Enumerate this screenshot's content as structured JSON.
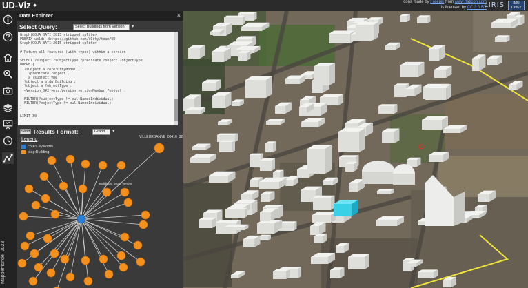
{
  "app": {
    "title": "UD-Viz •",
    "credits_line1_pre": "Icons made by",
    "credits_line1_link1": "Freepik",
    "credits_line1_mid": "from",
    "credits_line1_link2": "www.flaticon.com",
    "credits_line2_pre": "is licensed by",
    "credits_line2_link": "CC 3.0 BY",
    "logo_text": "LIRIS",
    "logo_box_text": "IMU LabEx"
  },
  "sidebar": {
    "items": [
      {
        "icon": "info-icon"
      },
      {
        "icon": "help-icon"
      },
      {
        "icon": "home-icon"
      },
      {
        "icon": "search-buildings-icon"
      },
      {
        "icon": "camera-icon"
      },
      {
        "icon": "layers-icon"
      },
      {
        "icon": "presentation-icon"
      },
      {
        "icon": "clock-icon"
      },
      {
        "icon": "graph-icon"
      }
    ],
    "copyright": "Mappemonde, 2023"
  },
  "panel": {
    "title": "Data Explorer",
    "close": "×",
    "query_label": "Select Query:",
    "query_value": "Select Buildings from Version",
    "query_caret": "▾",
    "editor_lines": [
      "Graph(GOUA_BATI_2015_stripped_splite>",
      "PREFIX ubld: <https://github.com/VCity/team/UD-",
      "Graph(GOUA_BATI_2015_stripped_splite>",
      "",
      "# Return all features (with types) within a version",
      "",
      "SELECT ?subject ?subjectType ?predicate ?object ?objectType",
      "WHERE {",
      "  ?subject a core:CityModel ;",
      "    ?predicate ?object .",
      "    a ?subjectType",
      "  ?object a bldg:Building ;",
      "  ?object a ?objectType .",
      "  <Version_0#2 vers:Version.versionMember ?object .",
      "",
      "  FILTER(?subjectType != owl:NamedIndividual)",
      "  FILTER(?objectType != owl:NamedIndividual)",
      "}",
      "",
      "LIMIT 30"
    ],
    "send_label": "Send",
    "results_label": "Results Format:",
    "format_value": "Graph",
    "format_caret": "▾",
    "legend_title": "Legend",
    "legend": [
      {
        "label": "core:CityModel",
        "color": "#2a7fd4"
      },
      {
        "label": "bldg:Building",
        "color": "#f4901e"
      }
    ],
    "graph": {
      "hub_label": "Buildings_2015_Version",
      "outer_label": "VILLEURBANNE_00416_32",
      "node_color": "#f4901e",
      "hub_color": "#2a7fd4"
    }
  }
}
